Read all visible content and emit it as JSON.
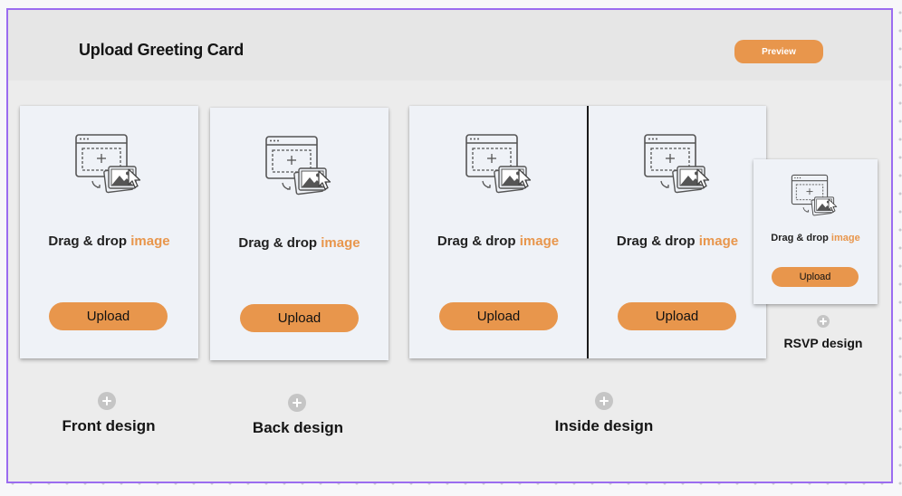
{
  "header": {
    "title": "Upload Greeting Card",
    "preview_label": "Preview"
  },
  "cards": {
    "front": {
      "drag_text": "Drag & drop",
      "drag_highlight": "image",
      "upload_label": "Upload",
      "caption": "Front design"
    },
    "back": {
      "drag_text": "Drag & drop",
      "drag_highlight": "image",
      "upload_label": "Upload",
      "caption": "Back design"
    },
    "inside_left": {
      "drag_text": "Drag & drop",
      "drag_highlight": "image",
      "upload_label": "Upload"
    },
    "inside_right": {
      "drag_text": "Drag & drop",
      "drag_highlight": "image",
      "upload_label": "Upload"
    },
    "inside_caption": "Inside design",
    "rsvp": {
      "drag_text": "Drag & drop",
      "drag_highlight": "image",
      "upload_label": "Upload",
      "caption": "RSVP design"
    }
  },
  "icons": {
    "upload_illustration": "image-upload-icon",
    "add": "plus-circle-icon"
  },
  "colors": {
    "accent": "#e8964c",
    "card_bg": "#eff2f7",
    "frame_border": "#9b6cf0",
    "header_bg": "#e6e6e6"
  }
}
